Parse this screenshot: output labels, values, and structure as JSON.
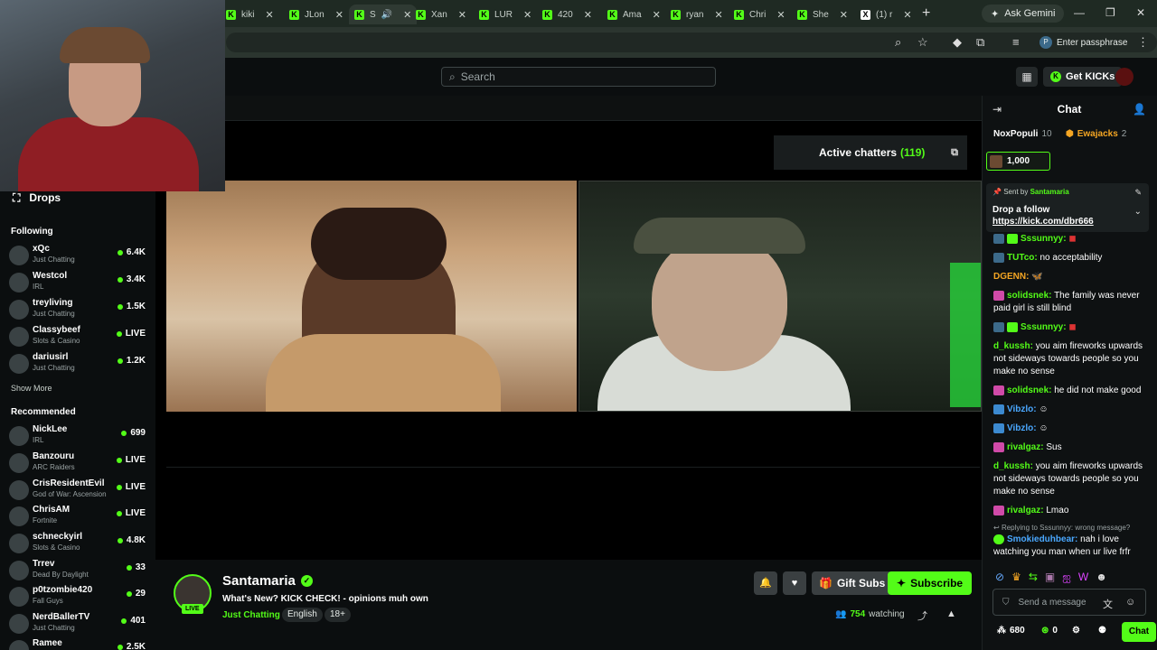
{
  "browser": {
    "tabs": [
      {
        "label": "kiki"
      },
      {
        "label": "JLon"
      },
      {
        "label": "S"
      },
      {
        "label": "Xan"
      },
      {
        "label": "LUR"
      },
      {
        "label": "420"
      },
      {
        "label": "Ama"
      },
      {
        "label": "ryan"
      },
      {
        "label": "Chri"
      },
      {
        "label": "She"
      },
      {
        "label": "(1) r"
      }
    ],
    "ask_gemini": "Ask Gemini",
    "passphrase": "Enter passphrase",
    "profile_initial": "P"
  },
  "header": {
    "search_placeholder": "Search",
    "get_kicks": "Get KICKs"
  },
  "sidebar": {
    "drops": "Drops",
    "following_title": "Following",
    "following": [
      {
        "name": "xQc",
        "category": "Just Chatting",
        "viewers": "6.4K"
      },
      {
        "name": "Westcol",
        "category": "IRL",
        "viewers": "3.4K"
      },
      {
        "name": "treyliving",
        "category": "Just Chatting",
        "viewers": "1.5K"
      },
      {
        "name": "Classybeef",
        "category": "Slots & Casino",
        "viewers": "LIVE"
      },
      {
        "name": "dariusirl",
        "category": "Just Chatting",
        "viewers": "1.2K"
      }
    ],
    "show_more": "Show More",
    "recommended_title": "Recommended",
    "recommended": [
      {
        "name": "NickLee",
        "category": "IRL",
        "viewers": "699"
      },
      {
        "name": "Banzouru",
        "category": "ARC Raiders",
        "viewers": "LIVE"
      },
      {
        "name": "CrisResidentEvil",
        "category": "God of War: Ascension",
        "viewers": "LIVE"
      },
      {
        "name": "ChrisAM",
        "category": "Fortnite",
        "viewers": "LIVE"
      },
      {
        "name": "schneckyirl",
        "category": "Slots & Casino",
        "viewers": "4.8K"
      },
      {
        "name": "Trrev",
        "category": "Dead By Daylight",
        "viewers": "33"
      },
      {
        "name": "p0tzombie420",
        "category": "Fall Guys",
        "viewers": "29"
      },
      {
        "name": "NerdBallerTV",
        "category": "Just Chatting",
        "viewers": "401"
      },
      {
        "name": "Ramee",
        "category": "",
        "viewers": "2.5K"
      }
    ]
  },
  "player": {
    "active_chatters_label": "Active chatters",
    "active_chatters_count": "(119)"
  },
  "stream": {
    "live": "LIVE",
    "streamer": "Santamaria",
    "title": "What's New? KICK CHECK! - opinions muh own",
    "category": "Just Chatting",
    "tags": [
      "English",
      "18+"
    ],
    "gift_subs": "Gift Subs",
    "subscribe": "Subscribe",
    "watching_count": "754",
    "watching_label": "watching"
  },
  "chat": {
    "title": "Chat",
    "top_tippers": [
      {
        "name": "NoxPopuli",
        "count": "10"
      },
      {
        "name": "Ewajacks",
        "count": "2"
      }
    ],
    "tip_amount": "1,000",
    "pinned": {
      "sent_by_label": "Sent by",
      "sent_by": "Santamaria",
      "text": "Drop a follow",
      "link": "https://kick.com/dbr666"
    },
    "messages": [
      {
        "user": "Sssunnyy:",
        "text": "",
        "color": "#53fc18"
      },
      {
        "user": "TUTco:",
        "text": "no acceptability",
        "color": "#53fc18"
      },
      {
        "user": "DGENN:",
        "text": "",
        "color": "#f5a623"
      },
      {
        "user": "solidsnek:",
        "text": "The family was never paid girl is still blind",
        "color": "#53fc18"
      },
      {
        "user": "Sssunnyy:",
        "text": "",
        "color": "#53fc18"
      },
      {
        "user": "d_kussh:",
        "text": "you aim fireworks upwards not sideways towards people so you make no sense",
        "color": "#53fc18"
      },
      {
        "user": "solidsnek:",
        "text": "he did not make good",
        "color": "#53fc18"
      },
      {
        "user": "Vibzlo:",
        "text": "",
        "color": "#53fc18"
      },
      {
        "user": "Vibzlo:",
        "text": "",
        "color": "#53fc18"
      },
      {
        "user": "rivalgaz:",
        "text": "Sus",
        "color": "#53fc18"
      },
      {
        "user": "d_kussh:",
        "text": "you aim fireworks upwards not sideways towards people so you make no sense",
        "color": "#53fc18"
      },
      {
        "user": "rivalgaz:",
        "text": "Lmao",
        "color": "#53fc18"
      },
      {
        "user": "Smokieduhbear:",
        "text": "nah i love watching you man when ur live frfr",
        "color": "#4aa8ff"
      }
    ],
    "reply_note": "Replying to Sssunnyy: wrong message?",
    "input_placeholder": "Send a message",
    "points": "680",
    "kicks": "0",
    "chat_button": "Chat"
  }
}
